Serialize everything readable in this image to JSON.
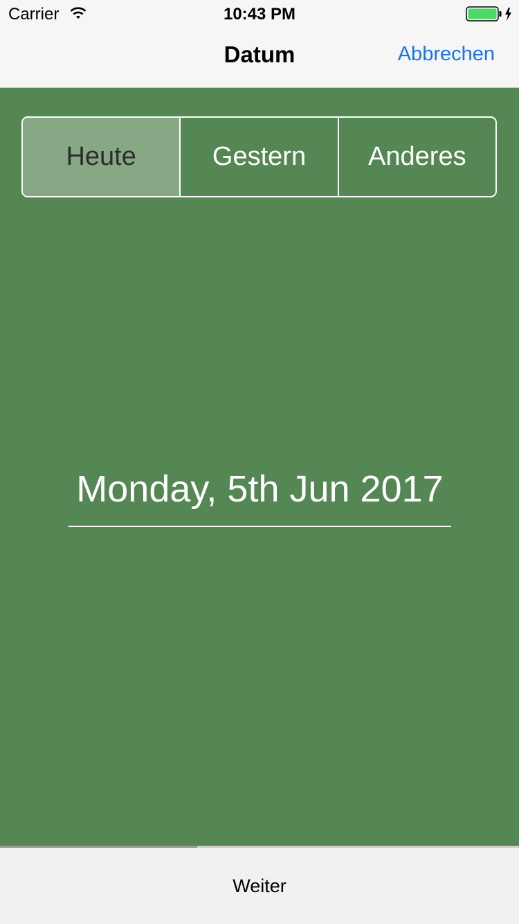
{
  "status_bar": {
    "carrier": "Carrier",
    "time": "10:43 PM",
    "wifi_icon": "wifi-icon",
    "battery_icon": "battery-charging-icon",
    "battery_color": "#4cd964"
  },
  "nav": {
    "title": "Datum",
    "cancel_label": "Abbrechen",
    "accent_color": "#1a73e8"
  },
  "segments": [
    {
      "label": "Heute",
      "selected": true
    },
    {
      "label": "Gestern",
      "selected": false
    },
    {
      "label": "Anderes",
      "selected": false
    }
  ],
  "date_display": "Monday, 5th Jun 2017",
  "progress": {
    "value": 0.38
  },
  "footer": {
    "next_label": "Weiter"
  },
  "colors": {
    "background_green": "#558754",
    "selected_segment": "#86a885"
  }
}
